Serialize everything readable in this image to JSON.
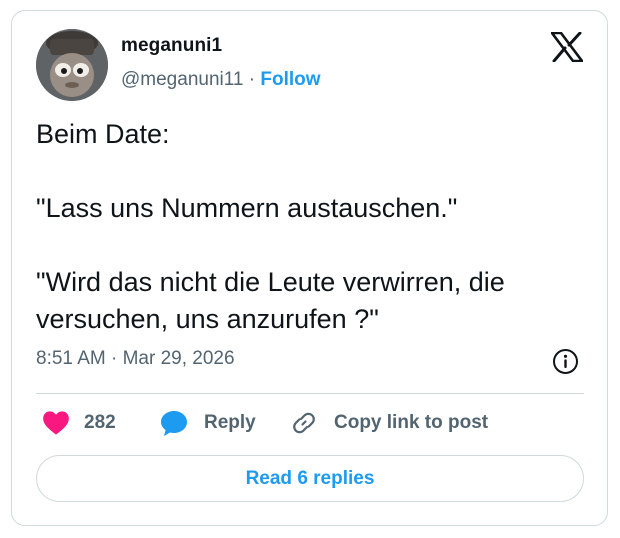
{
  "author": {
    "display_name": "meganuni1",
    "handle": "@meganuni11",
    "separator": " · ",
    "follow_label": "Follow"
  },
  "tweet": {
    "text": "Beim Date:\n\n\"Lass uns Nummern austauschen.\"\n\n\"Wird das nicht die Leute verwirren, die versuchen, uns anzurufen ?\""
  },
  "meta": {
    "time": "8:51 AM",
    "separator": " · ",
    "date": "Mar 29, 2026"
  },
  "actions": {
    "likes_count": "282",
    "reply_label": "Reply",
    "copy_label": "Copy link to post"
  },
  "read_replies_label": "Read 6 replies",
  "icons": {
    "avatar": "profile-avatar",
    "brand": "x-logo-icon",
    "info": "info-icon",
    "like": "heart-icon",
    "reply": "speech-bubble-icon",
    "copy": "link-icon"
  },
  "colors": {
    "accent": "#1d9bf0",
    "like": "#f91880",
    "text": "#0f1419",
    "muted": "#536471",
    "border": "#cfd9de"
  }
}
